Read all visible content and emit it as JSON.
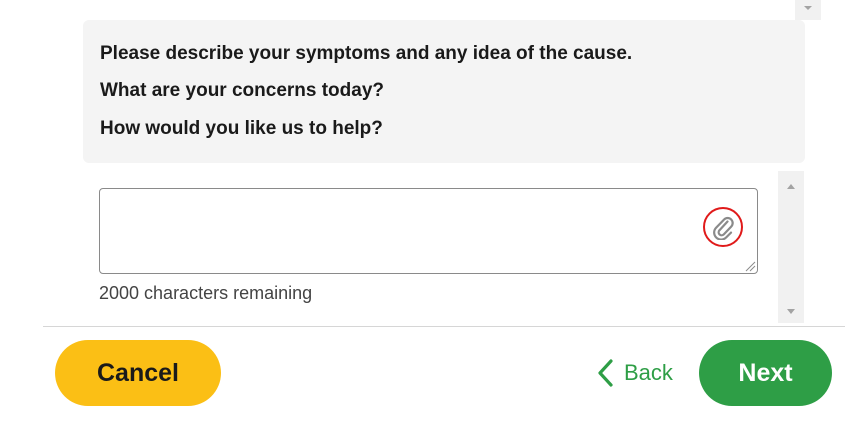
{
  "question": {
    "line1": "Please describe your symptoms and any idea of the cause.",
    "line2": "What are your concerns today?",
    "line3": "How would you like us to help?"
  },
  "message": {
    "value": "",
    "char_remaining": "2000 characters remaining",
    "attach_icon": "paperclip-icon"
  },
  "footer": {
    "cancel_label": "Cancel",
    "back_label": "Back",
    "next_label": "Next"
  },
  "colors": {
    "cancel": "#fbbf15",
    "primary": "#2e9e46",
    "highlight_ring": "#e01a1a"
  }
}
